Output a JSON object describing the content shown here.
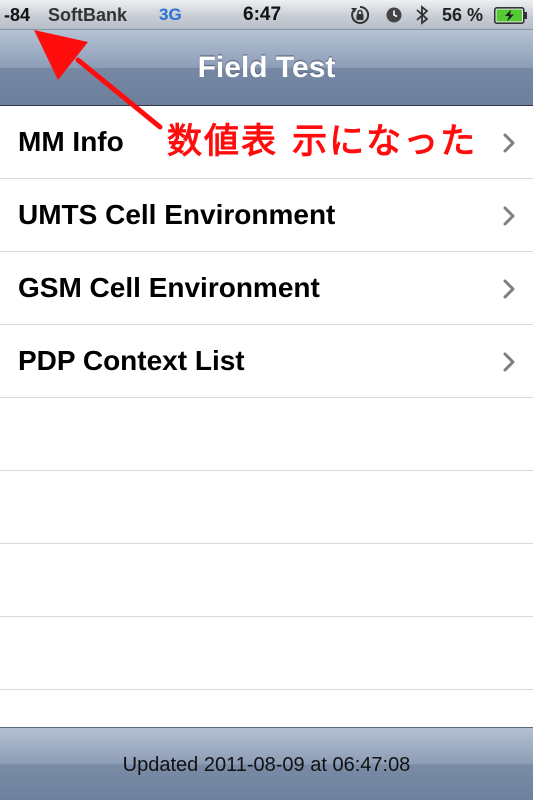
{
  "status_bar": {
    "signal": "-84",
    "carrier": "SoftBank",
    "network": "3G",
    "time": "6:47",
    "battery_percent": "56 %"
  },
  "nav": {
    "title": "Field Test"
  },
  "table": {
    "rows": [
      {
        "label": "MM Info"
      },
      {
        "label": "UMTS Cell Environment"
      },
      {
        "label": "GSM Cell Environment"
      },
      {
        "label": "PDP Context List"
      },
      {
        "label": ""
      },
      {
        "label": ""
      },
      {
        "label": ""
      },
      {
        "label": ""
      },
      {
        "label": ""
      }
    ]
  },
  "annotation": {
    "text": "数値表 示になった",
    "color": "#ff0d0d"
  },
  "toolbar": {
    "updated": "Updated 2011-08-09 at 06:47:08"
  },
  "icons": {
    "rotation_lock": "rotation-lock-icon",
    "alarm": "alarm-icon",
    "bluetooth": "bluetooth-icon",
    "battery": "battery-charging-icon",
    "chevron": "chevron-right-icon"
  }
}
